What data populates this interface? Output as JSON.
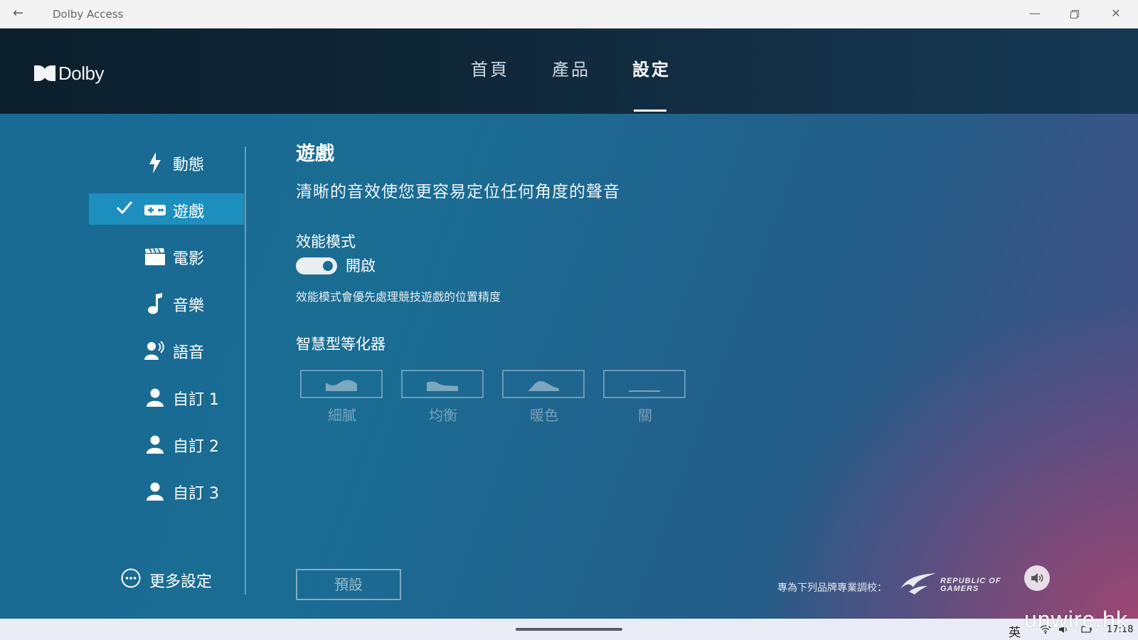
{
  "window": {
    "title": "Dolby Access",
    "back_icon": "back-arrow-icon"
  },
  "brand": {
    "name": "Dolby"
  },
  "nav": {
    "tabs": [
      {
        "label": "首頁",
        "active": false
      },
      {
        "label": "產品",
        "active": false
      },
      {
        "label": "設定",
        "active": true
      }
    ]
  },
  "sidebar": {
    "items": [
      {
        "label": "動態",
        "icon": "lightning-icon",
        "active": false
      },
      {
        "label": "遊戲",
        "icon": "gamepad-icon",
        "active": true
      },
      {
        "label": "電影",
        "icon": "clapperboard-icon",
        "active": false
      },
      {
        "label": "音樂",
        "icon": "music-note-icon",
        "active": false
      },
      {
        "label": "語音",
        "icon": "voice-icon",
        "active": false
      },
      {
        "label": "自訂 1",
        "icon": "person-icon",
        "active": false
      },
      {
        "label": "自訂 2",
        "icon": "person-icon",
        "active": false
      },
      {
        "label": "自訂 3",
        "icon": "person-icon",
        "active": false
      }
    ],
    "more_settings": "更多設定"
  },
  "content": {
    "title": "遊戲",
    "description": "清晰的音效使您更容易定位任何角度的聲音",
    "performance_mode": {
      "label": "效能模式",
      "state": "開啟",
      "enabled": true,
      "description": "效能模式會優先處理競技遊戲的位置精度"
    },
    "equalizer": {
      "title": "智慧型等化器",
      "options": [
        "細膩",
        "均衡",
        "暖色",
        "關"
      ]
    },
    "default_button": "預設"
  },
  "footer": {
    "tuned_for": "專為下列品牌專業調校：",
    "rog_line1": "REPUBLIC OF",
    "rog_line2": "GAMERS"
  },
  "taskbar": {
    "ime": "英",
    "time": "17:18"
  },
  "watermark": "unwire.hk",
  "colors": {
    "active_item": "#1d8fbf",
    "header_bg": "#0b1e2c",
    "main_bg": "#186a93"
  }
}
